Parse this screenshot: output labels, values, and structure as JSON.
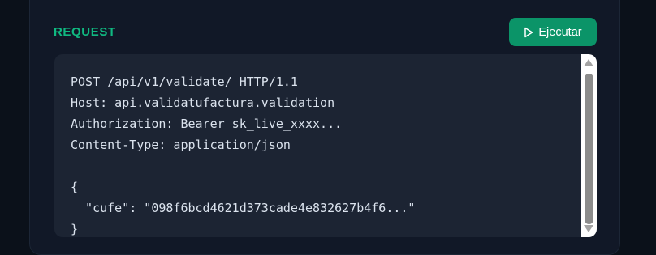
{
  "request": {
    "title": "REQUEST",
    "run_button_label": "Ejecutar",
    "run_icon": "play-icon",
    "code_lines": [
      "POST /api/v1/validate/ HTTP/1.1",
      "Host: api.validatufactura.validation",
      "Authorization: Bearer sk_live_xxxx...",
      "Content-Type: application/json",
      "",
      "{",
      "  \"cufe\": \"098f6bcd4621d373cade4e832627b4f6...\"",
      "}"
    ]
  },
  "colors": {
    "accent": "#10b981",
    "button": "#0b9468",
    "code_background": "#1c2433",
    "panel_background": "#111827",
    "page_background": "#0b111a"
  }
}
